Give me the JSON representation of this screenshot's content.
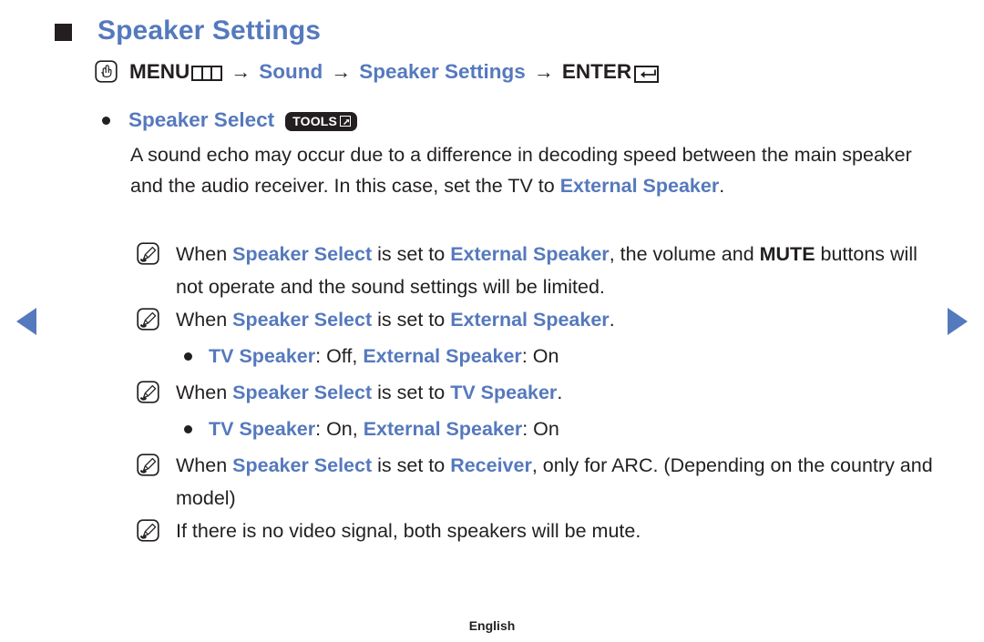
{
  "page": {
    "title": "Speaker Settings",
    "footer_language": "English"
  },
  "nav": {
    "prev_label": "Previous page",
    "next_label": "Next page"
  },
  "menu_path": {
    "remote_icon": "hand-pointer-icon",
    "menu_label": "MENU",
    "menu_icon": "menu-bars-icon",
    "arrow": "→",
    "sound_label": "Sound",
    "speaker_settings_label": "Speaker Settings",
    "enter_label": "ENTER",
    "enter_icon": "enter-return-icon"
  },
  "setting": {
    "name": "Speaker Select",
    "tools_badge": "TOOLS",
    "tools_glyph": "tools-arrow-icon",
    "description_parts": [
      {
        "text": "A sound echo may occur due to a difference in decoding speed between the main speaker and the audio receiver. In this case, set the TV to ",
        "style": "plain"
      },
      {
        "text": "External Speaker",
        "style": "blue-bold"
      },
      {
        "text": ".",
        "style": "plain"
      }
    ]
  },
  "notes": [
    {
      "icon": "note-pencil-icon",
      "parts": [
        {
          "text": "When ",
          "style": "plain"
        },
        {
          "text": "Speaker Select",
          "style": "blue-bold"
        },
        {
          "text": " is set to ",
          "style": "plain"
        },
        {
          "text": "External Speaker",
          "style": "blue-bold"
        },
        {
          "text": ", the volume and ",
          "style": "plain"
        },
        {
          "text": "MUTE",
          "style": "dark-bold"
        },
        {
          "text": " buttons will not operate and the sound settings will be limited.",
          "style": "plain"
        }
      ],
      "sub": null
    },
    {
      "icon": "note-pencil-icon",
      "parts": [
        {
          "text": "When ",
          "style": "plain"
        },
        {
          "text": "Speaker Select",
          "style": "blue-bold"
        },
        {
          "text": " is set to ",
          "style": "plain"
        },
        {
          "text": "External Speaker",
          "style": "blue-bold"
        },
        {
          "text": ".",
          "style": "plain"
        }
      ],
      "sub": [
        {
          "text": "TV Speaker",
          "style": "blue-bold"
        },
        {
          "text": ": Off, ",
          "style": "plain"
        },
        {
          "text": "External Speaker",
          "style": "blue-bold"
        },
        {
          "text": ": On",
          "style": "plain"
        }
      ]
    },
    {
      "icon": "note-pencil-icon",
      "parts": [
        {
          "text": "When ",
          "style": "plain"
        },
        {
          "text": "Speaker Select",
          "style": "blue-bold"
        },
        {
          "text": " is set to ",
          "style": "plain"
        },
        {
          "text": "TV Speaker",
          "style": "blue-bold"
        },
        {
          "text": ".",
          "style": "plain"
        }
      ],
      "sub": [
        {
          "text": "TV Speaker",
          "style": "blue-bold"
        },
        {
          "text": ": On, ",
          "style": "plain"
        },
        {
          "text": "External Speaker",
          "style": "blue-bold"
        },
        {
          "text": ": On",
          "style": "plain"
        }
      ]
    },
    {
      "icon": "note-pencil-icon",
      "parts": [
        {
          "text": "When ",
          "style": "plain"
        },
        {
          "text": "Speaker Select",
          "style": "blue-bold"
        },
        {
          "text": " is set to ",
          "style": "plain"
        },
        {
          "text": "Receiver",
          "style": "blue-bold"
        },
        {
          "text": ", only for ARC. (Depending on the country and model)",
          "style": "plain"
        }
      ],
      "sub": null
    },
    {
      "icon": "note-pencil-icon",
      "parts": [
        {
          "text": "If there is no video signal, both speakers will be mute.",
          "style": "plain"
        }
      ],
      "sub": null
    }
  ],
  "colors": {
    "accent_blue": "#5579bd",
    "text_dark": "#231f20",
    "background": "#ffffff"
  }
}
